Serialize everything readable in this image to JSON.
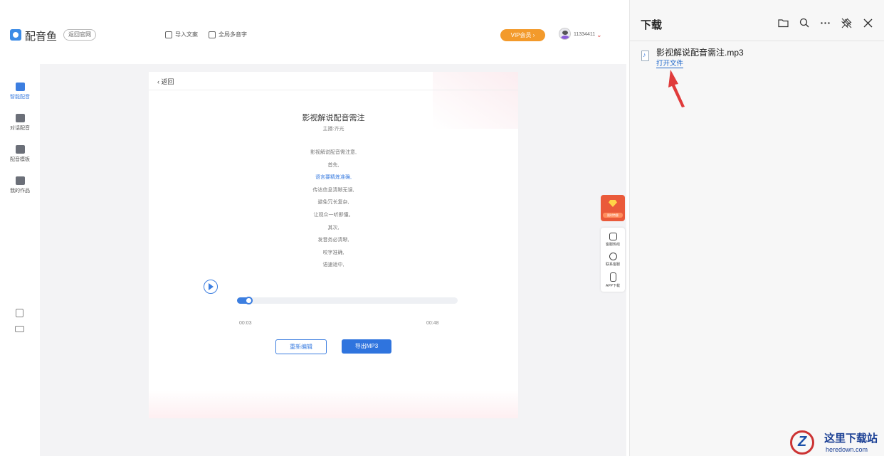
{
  "app": {
    "name": "配音鱼",
    "back_official": "返回官网",
    "import_text": "导入文案",
    "global_polyphone": "全局多音字",
    "vip": "VIP会员 ›",
    "user_id": "11334411"
  },
  "leftnav": {
    "items": [
      {
        "label": "智能配音"
      },
      {
        "label": "对话配音"
      },
      {
        "label": "配音模板"
      },
      {
        "label": "我的作品"
      }
    ]
  },
  "card": {
    "back": "返回",
    "title": "影视解说配音需注",
    "author": "主播:齐光",
    "lines": [
      "影视解说配音需注意,",
      "首先,",
      "语言要精炼准确,",
      "传达信息清晰无误,",
      "避免冗长复杂,",
      "让观众一听即懂。",
      "其次,",
      "发音务必清晰,",
      "咬字准确,",
      "语速适中,"
    ]
  },
  "player": {
    "progress": 0.06,
    "time_start": "00:03",
    "time_end": "00:48"
  },
  "buttons": {
    "reedit": "重新编辑",
    "export": "导出MP3"
  },
  "float": {
    "promo": "限时特惠",
    "tools": [
      {
        "label": "客服热线"
      },
      {
        "label": "联系客服"
      },
      {
        "label": "APP下载"
      }
    ]
  },
  "download": {
    "title": "下载",
    "file_name": "影视解说配音需注.mp3",
    "open_file": "打开文件"
  },
  "watermark": {
    "cn": "这里下载站",
    "en": "heredown.com"
  },
  "colors": {
    "accent": "#3c7ee0",
    "vip": "#f39a2b",
    "promo": "#ea5a3a",
    "arrow": "#e03b3b"
  }
}
